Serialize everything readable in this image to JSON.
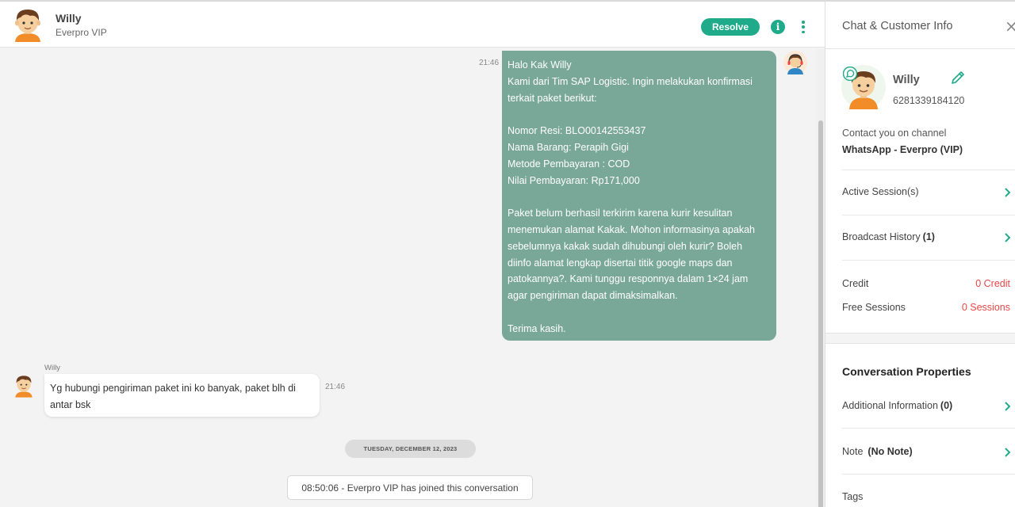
{
  "header": {
    "contact_name": "Willy",
    "contact_sub": "Everpro VIP",
    "resolve_label": "Resolve",
    "info_glyph": "i"
  },
  "messages": {
    "outgoing": {
      "time": "21:46",
      "paragraphs": [
        [
          "Halo Kak Willy",
          "Kami dari Tim SAP Logistic. Ingin melakukan konfirmasi",
          "terkait paket berikut:"
        ],
        [
          "Nomor Resi: BLO00142553437",
          "Nama Barang: Perapih Gigi",
          "Metode Pembayaran : COD",
          "Nilai Pembayaran: Rp171,000"
        ],
        [
          "Paket belum berhasil terkirim karena kurir kesulitan",
          "menemukan alamat Kakak. Mohon informasinya apakah",
          "sebelumnya kakak sudah dihubungi oleh kurir? Boleh",
          "diinfo alamat lengkap disertai titik google maps dan",
          "patokannya?. Kami tunggu responnya dalam 1×24 jam",
          "agar pengiriman dapat dimaksimalkan."
        ],
        [
          "Terima kasih."
        ]
      ]
    },
    "incoming": {
      "sender": "Willy",
      "time": "21:46",
      "lines": [
        "Yg hubungi pengiriman paket ini ko banyak, paket blh di",
        "antar bsk"
      ]
    },
    "date_divider": "TUESDAY, DECEMBER 12, 2023",
    "system_message": "08:50:06 - Everpro VIP has joined this conversation"
  },
  "panel": {
    "title": "Chat & Customer Info",
    "close_glyph": "×",
    "name": "Willy",
    "phone": "6281339184120",
    "channel_label": "Contact you on channel",
    "channel_value": "WhatsApp - Everpro (VIP)",
    "active_sessions": "Active Session(s)",
    "broadcast_history": "Broadcast History",
    "broadcast_count": "(1)",
    "credit_label": "Credit",
    "credit_value": "0 Credit",
    "free_sessions_label": "Free Sessions",
    "free_sessions_value": "0 Sessions",
    "conversation_properties": "Conversation Properties",
    "additional_info": "Additional Information",
    "additional_info_count": "(0)",
    "note_label": "Note",
    "note_value": "(No Note)",
    "tags_label": "Tags"
  },
  "colors": {
    "accent": "#1fab8a",
    "outgoing_bubble": "#79a898",
    "credit_red": "#e84747"
  },
  "icons": [
    "user-avatar-icon",
    "agent-headset-avatar-icon",
    "info-icon",
    "more-vertical-icon",
    "close-icon",
    "edit-pencil-icon",
    "whatsapp-badge-icon",
    "chevron-right-icon"
  ]
}
